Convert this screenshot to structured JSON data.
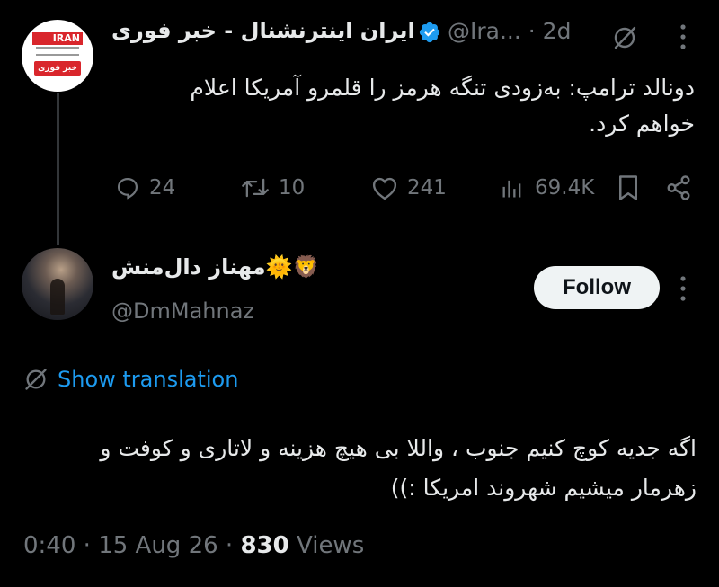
{
  "parent_tweet": {
    "avatar_logo": {
      "top": "IRAN",
      "bottom": "خبر فوری"
    },
    "author_name": "ایران اینترنشنال - خبر فوری",
    "handle": "@Ira...",
    "separator": "·",
    "time": "2d",
    "text": "دونالد ترامپ: به‌زودی تنگه هرمز را قلمرو آمریکا اعلام خواهم کرد.",
    "stats": {
      "replies": "24",
      "retweets": "10",
      "likes": "241",
      "views": "69.4K"
    }
  },
  "reply_tweet": {
    "author_name": "مهناز دال‌منش🌞🦁",
    "handle": "@DmMahnaz",
    "follow_label": "Follow",
    "show_translation": "Show translation",
    "text": "اگه جدیه کوچ کنیم جنوب ، واللا بی هیچ هزینه و لاتاری و کوفت و زهرمار میشیم شهروند امریکا :))",
    "time": "0:40",
    "date": "15 Aug 26",
    "views_count": "830",
    "views_label": "Views",
    "dot": "·"
  },
  "colors": {
    "background": "#000000",
    "text_primary": "#e7e9ea",
    "text_secondary": "#71767b",
    "link": "#1d9bf0",
    "verified": "#1d9bf0",
    "follow_bg": "#eff3f4"
  },
  "icons": [
    "grok-icon",
    "more-icon",
    "reply-icon",
    "retweet-icon",
    "like-icon",
    "views-icon",
    "bookmark-icon",
    "share-icon",
    "verified-icon",
    "translate-icon"
  ]
}
